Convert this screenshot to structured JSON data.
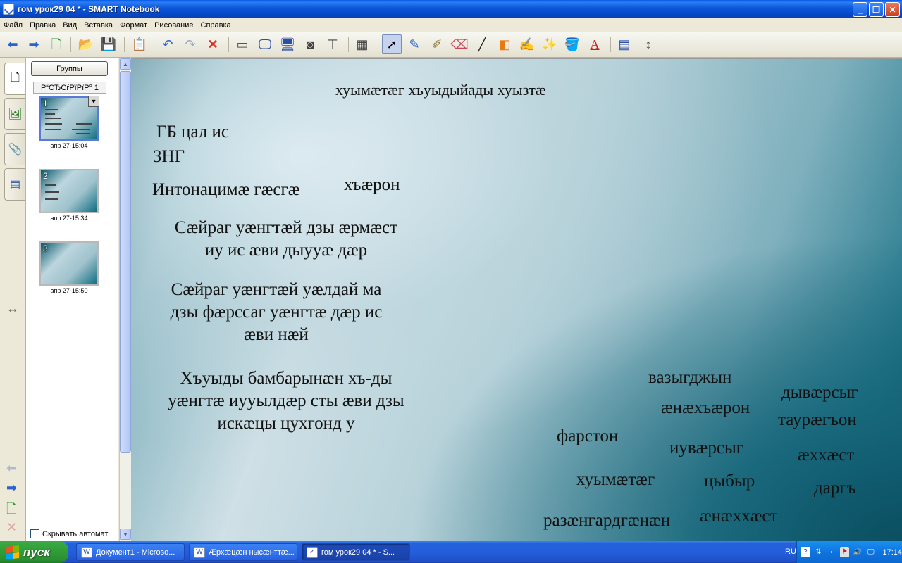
{
  "window": {
    "title": "гом урок29  04 * - SMART Notebook"
  },
  "menu": [
    "Файл",
    "Правка",
    "Вид",
    "Вставка",
    "Формат",
    "Рисование",
    "Справка"
  ],
  "toolbar": {
    "icons": [
      "back-arrow-icon",
      "forward-arrow-icon",
      "add-page-icon",
      "open-folder-icon",
      "save-icon",
      "paste-icon",
      "undo-icon",
      "redo-icon",
      "delete-icon",
      "screen-shade-icon",
      "full-screen-icon",
      "dual-display-icon",
      "capture-icon",
      "document-camera-icon",
      "table-icon",
      "select-icon",
      "pen-icon",
      "creative-pen-icon",
      "eraser-icon",
      "line-icon",
      "shapes-icon",
      "magic-pen-icon",
      "highlighter-icon",
      "fill-icon",
      "text-icon",
      "properties-icon",
      "move-toolbar-icon"
    ],
    "active": "select-icon"
  },
  "sorter": {
    "groups_label": "Группы",
    "group_name": "Р“СЂСѓРїРїР° 1",
    "pages": [
      {
        "num": "1",
        "date": "апр 27-15:04"
      },
      {
        "num": "2",
        "date": "апр 27-15:34"
      },
      {
        "num": "3",
        "date": "апр 27-15:50"
      }
    ],
    "autohide_label": "Скрывать автомат"
  },
  "canvas": {
    "title": "хуымæтæг хъуыдыйады хуызтæ",
    "left_blocks": [
      "ГБ цал ис",
      "ЗНГ",
      "Интонацимæ гæсгæ",
      "хъæрон",
      "Сæйраг уæнгтæй дзы æрмæст",
      "иу ис æви дыууæ дæр",
      "Сæйраг  уæнгтæй  уæлдай  ма",
      "дзы фæрссаг уæнгтæ дæр ис",
      "æви нæй",
      "Хъуыды бамбарынæн хъ-ды",
      "уæнгтæ иууылдæр сты  æви дзы",
      "искæцы цухгонд у"
    ],
    "right_words": [
      "вазыгджын",
      "дывæрсыг",
      "æнæхъæрон",
      "таурæгъон",
      "фарстон",
      "иувæрсыг",
      "æххæст",
      "хуымæтæг",
      "цыбыр",
      "даргъ",
      "разæнгардгæнæн",
      "æнæххæст"
    ]
  },
  "taskbar": {
    "start_label": "пуск",
    "tasks": [
      {
        "label": "Документ1 - Microso..."
      },
      {
        "label": "Æрхæцæн нысæнттæ..."
      },
      {
        "label": "гом урок29  04 * - S..."
      }
    ],
    "lang": "RU",
    "clock": "17:14"
  }
}
